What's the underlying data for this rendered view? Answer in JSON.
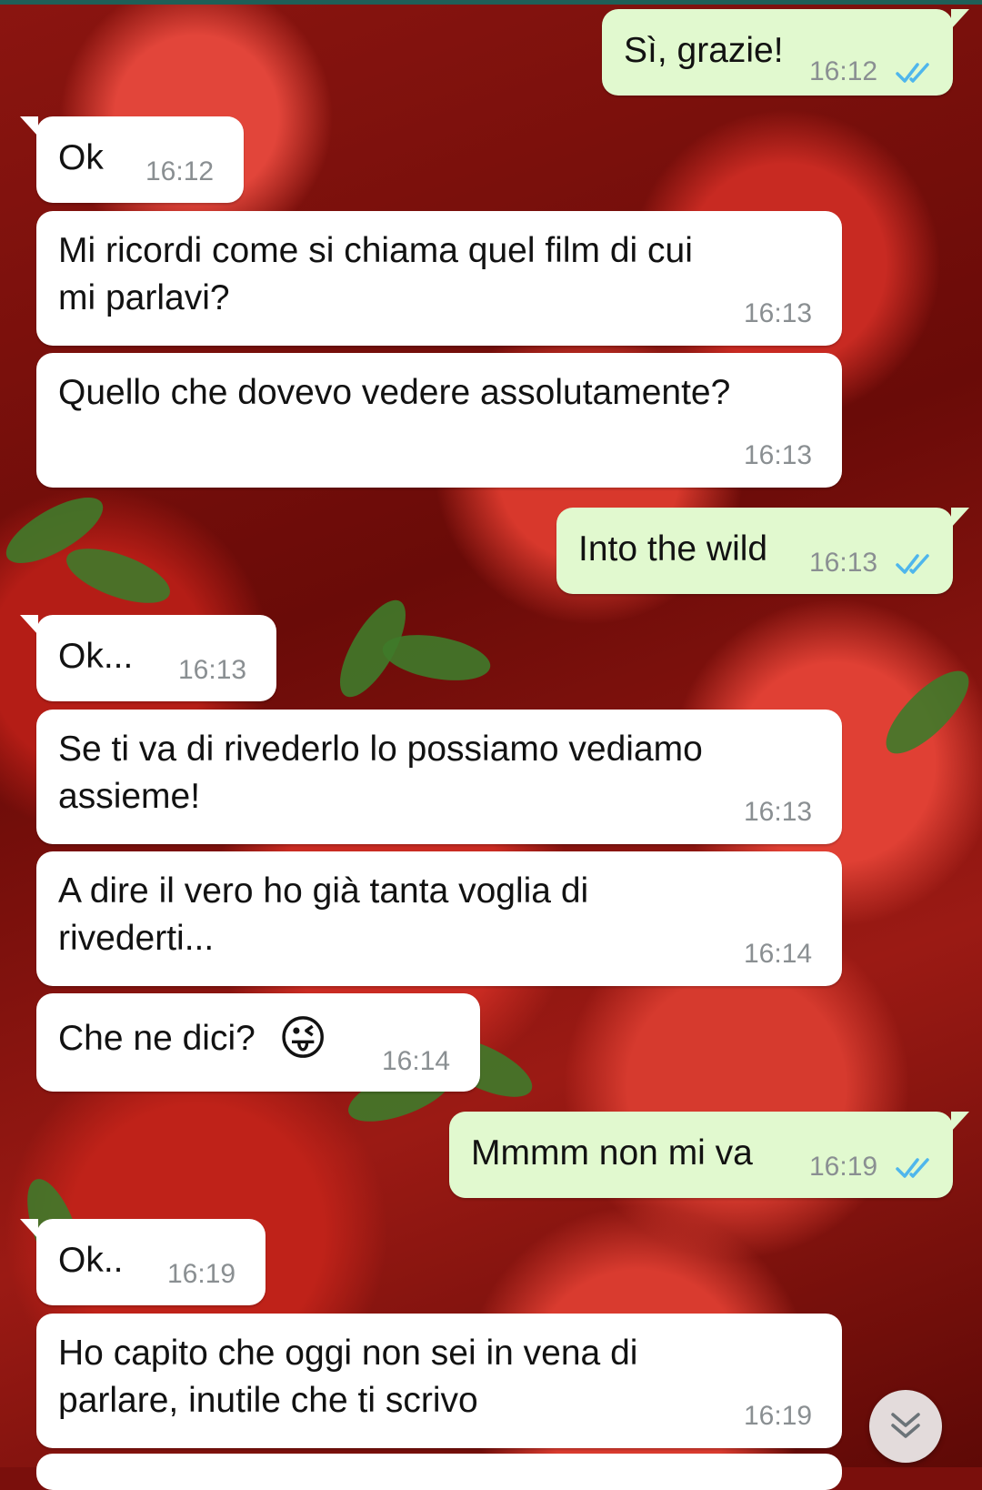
{
  "chat": {
    "messages": [
      {
        "direction": "outgoing",
        "text": "Sì, grazie!",
        "time": "16:12",
        "status": "read"
      },
      {
        "direction": "incoming",
        "text": "Ok",
        "time": "16:12"
      },
      {
        "direction": "incoming",
        "text": "Mi ricordi come si chiama quel film di cui\nmi parlavi?",
        "time": "16:13"
      },
      {
        "direction": "incoming",
        "text": "Quello che dovevo vedere assolutamente?",
        "time": "16:13"
      },
      {
        "direction": "outgoing",
        "text": "Into the wild",
        "time": "16:13",
        "status": "read"
      },
      {
        "direction": "incoming",
        "text": "Ok...",
        "time": "16:13"
      },
      {
        "direction": "incoming",
        "text": "Se ti va di rivederlo lo possiamo vediamo\nassieme!",
        "time": "16:13"
      },
      {
        "direction": "incoming",
        "text": "A dire il vero ho già tanta voglia di\nrivederti...",
        "time": "16:14"
      },
      {
        "direction": "incoming",
        "text": "Che ne dici?",
        "emoji": "😜",
        "time": "16:14"
      },
      {
        "direction": "outgoing",
        "text": "Mmmm non mi va",
        "time": "16:19",
        "status": "read"
      },
      {
        "direction": "incoming",
        "text": "Ok..",
        "time": "16:19"
      },
      {
        "direction": "incoming",
        "text": "Ho capito che oggi non sei in vena di\nparlare, inutile che ti scrivo",
        "time": "16:19"
      }
    ]
  },
  "wallpaper": {
    "subject": "strawberries"
  },
  "icons": {
    "read_receipt": "double-check-icon",
    "scroll_down": "double-chevron-down-icon"
  },
  "colors": {
    "outgoing_bubble": "#e1f9cf",
    "incoming_bubble": "#ffffff",
    "read_tick": "#4fb6ec",
    "timestamp": "#8a8f92"
  }
}
